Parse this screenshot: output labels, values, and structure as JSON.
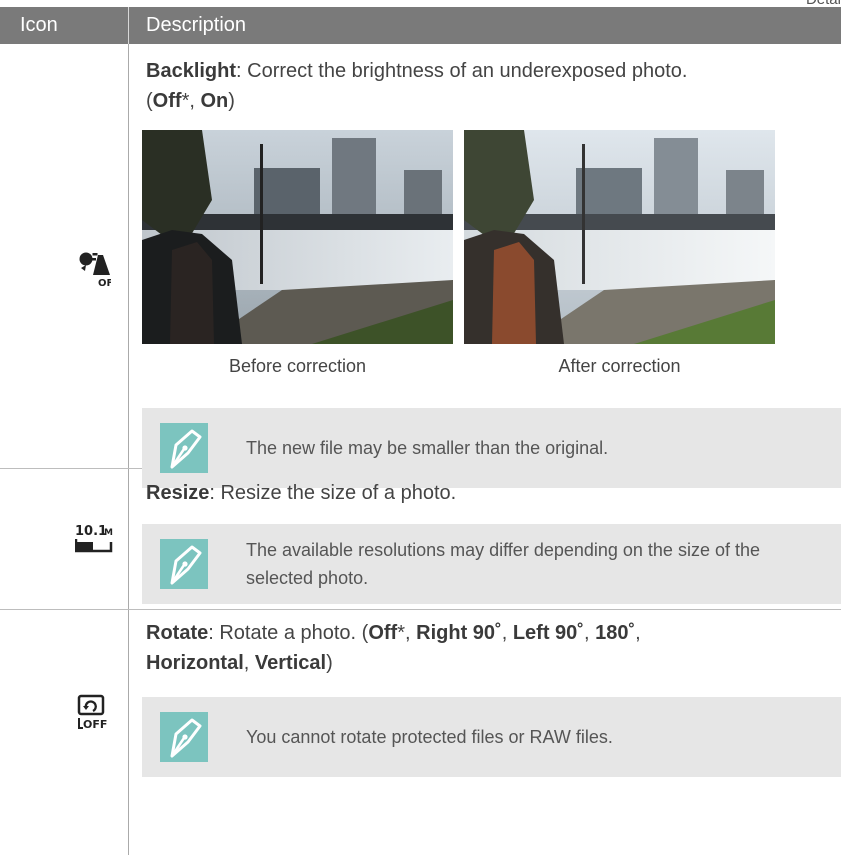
{
  "corner_label": "Detai",
  "table": {
    "header_icon": "Icon",
    "header_description": "Description"
  },
  "backlight": {
    "icon": "backlight-off-icon",
    "title": "Backlight",
    "text": ": Correct the brightness of an underexposed photo.",
    "opt_open": "(",
    "opt_off": "Off",
    "opt_star": "*",
    "opt_sep": ", ",
    "opt_on": "On",
    "opt_close": ")",
    "caption_before": "Before correction",
    "caption_after": "After correction",
    "note": "The new file may be smaller than the original."
  },
  "resize": {
    "icon": "resize-10-1m-icon",
    "icon_text": "10.1M",
    "title": "Resize",
    "text": ": Resize the size of a photo.",
    "note": "The available resolutions may differ depending on the size of the selected photo."
  },
  "rotate": {
    "icon": "rotate-off-icon",
    "title": "Rotate",
    "text": ": Rotate a photo. (",
    "opt_off": "Off",
    "opt_star": "*",
    "sep": ", ",
    "opt_right": "Right 90˚",
    "opt_left": "Left 90˚",
    "opt_180": "180˚",
    "sep2": ",",
    "opt_horizontal": "Horizontal",
    "opt_vertical": "Vertical",
    "close": ")",
    "note": "You cannot rotate protected files or RAW files."
  },
  "colors": {
    "header_bg": "#7a7a7a",
    "note_bg": "#e6e6e6",
    "note_icon_bg": "#7cc4bf"
  }
}
